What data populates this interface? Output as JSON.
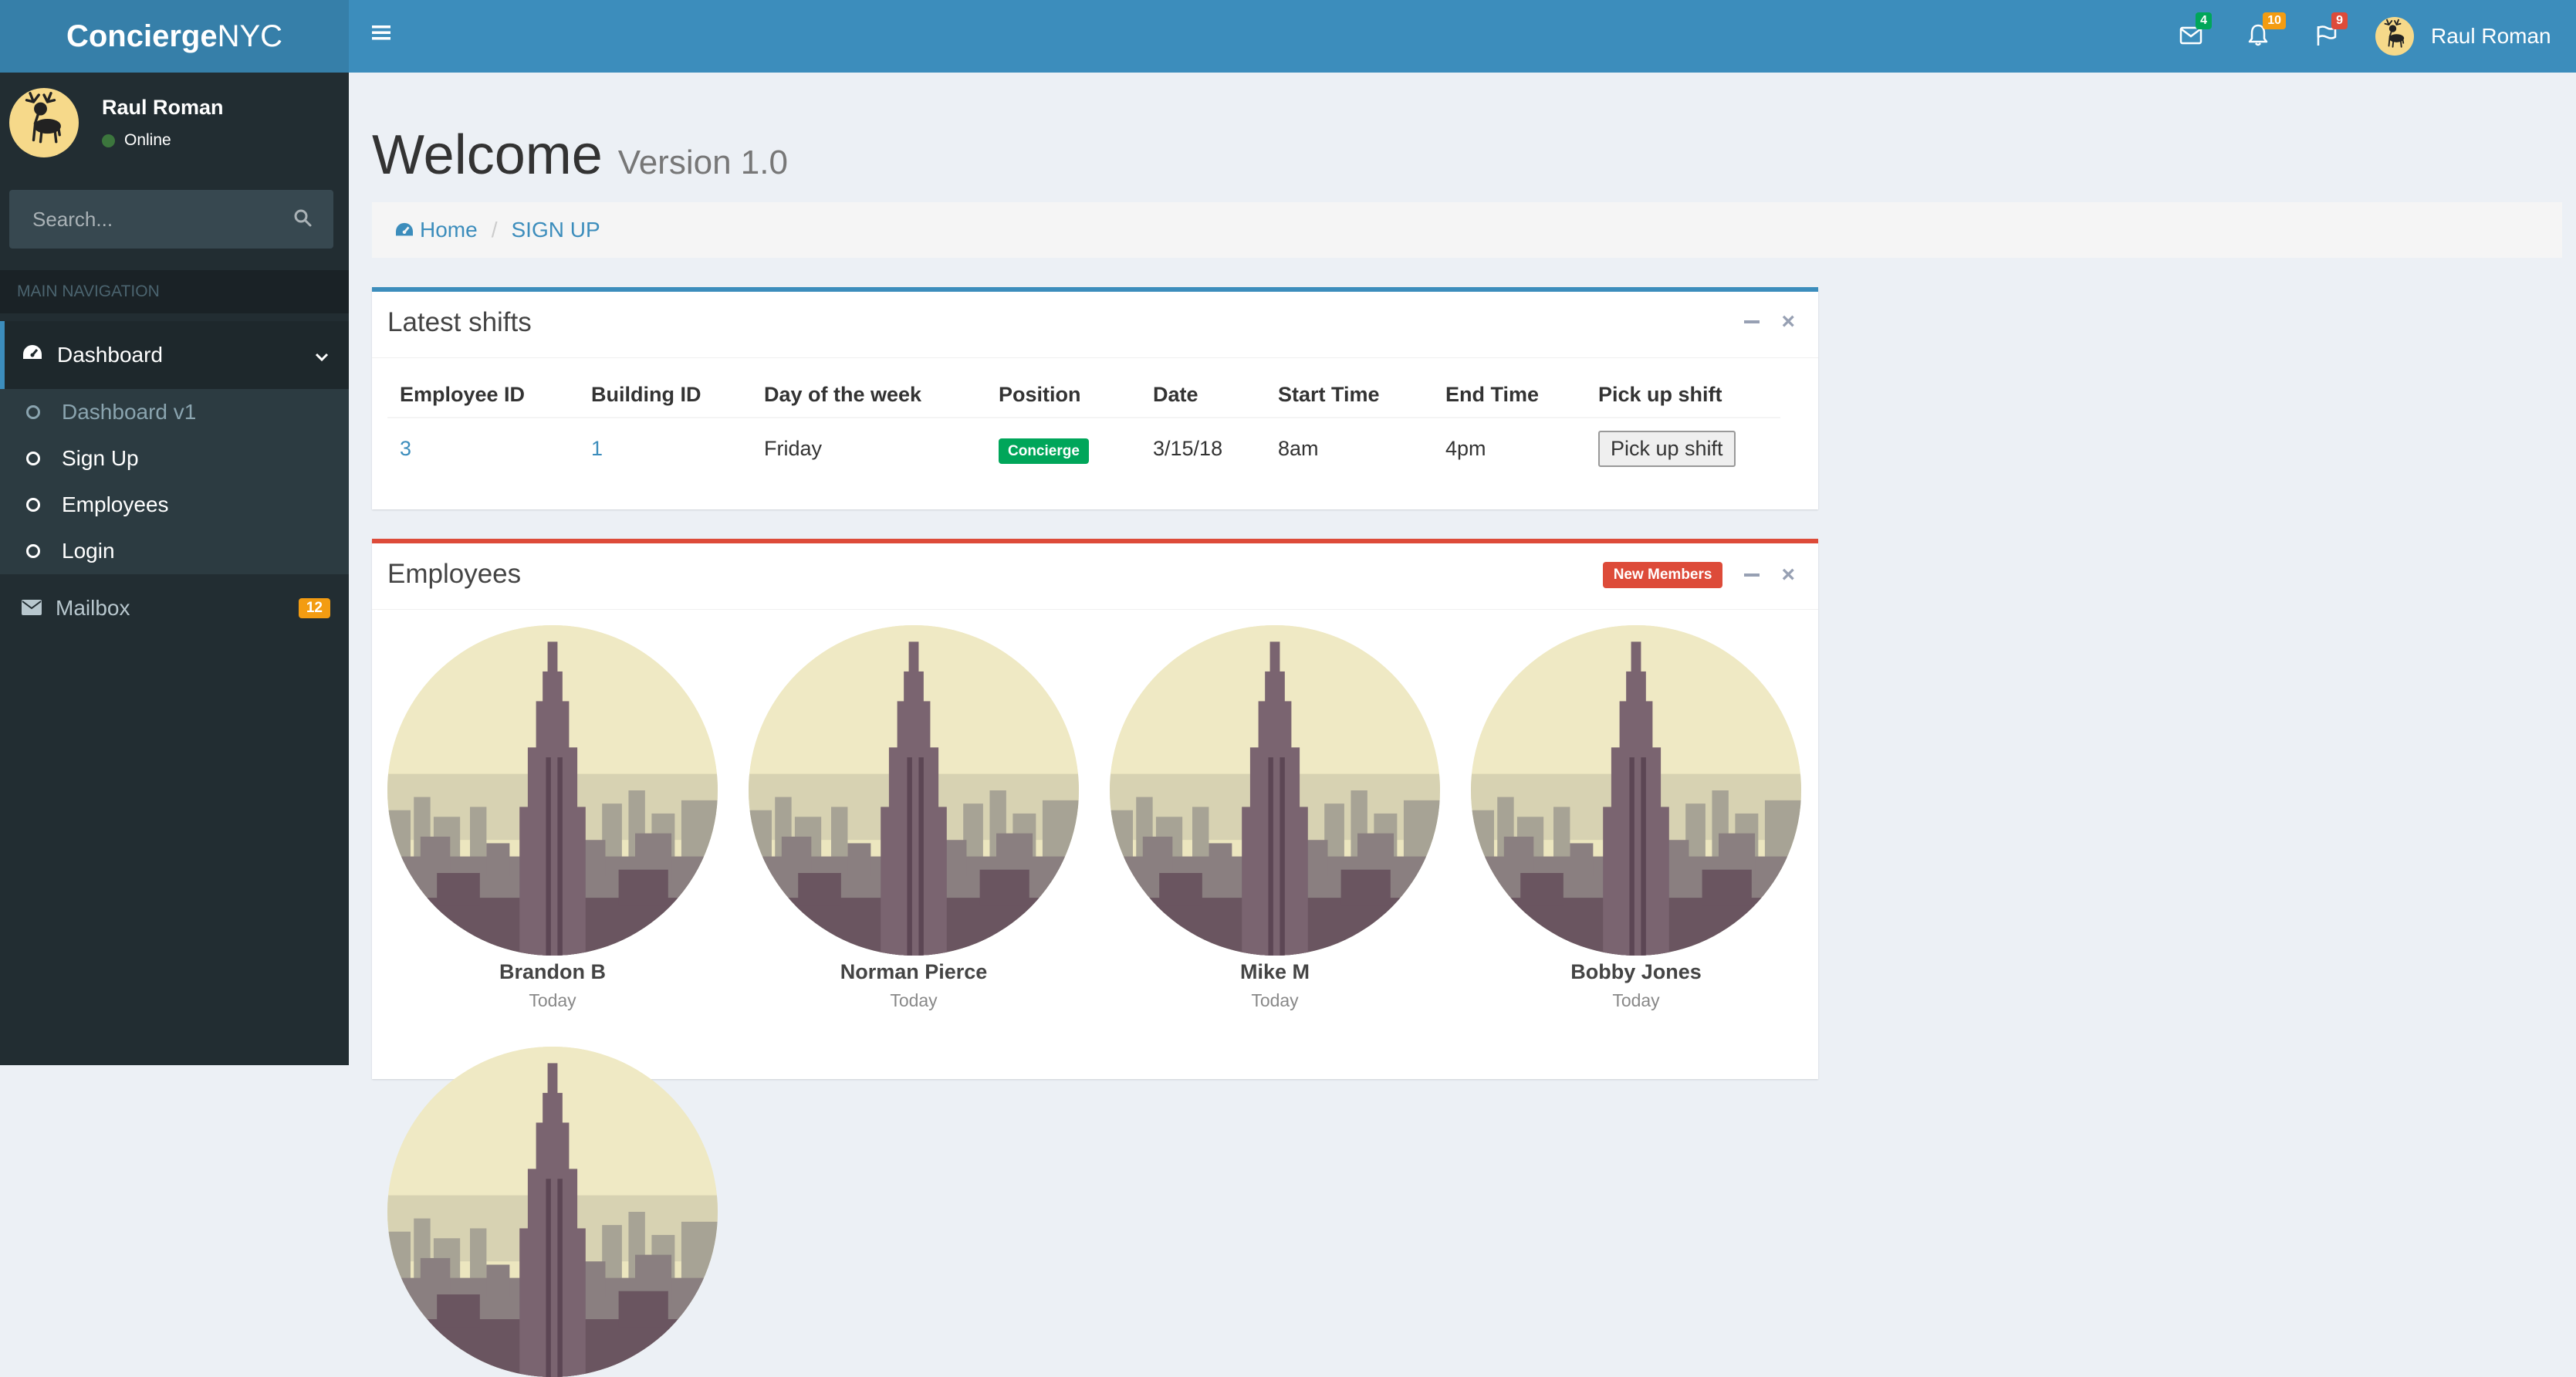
{
  "brand": {
    "bold": "Concierge",
    "light": "NYC"
  },
  "sidebar": {
    "user_name": "Raul Roman",
    "status": "Online",
    "search_placeholder": "Search...",
    "nav_header": "MAIN NAVIGATION",
    "dashboard_label": "Dashboard",
    "sub_items": [
      {
        "label": "Dashboard v1"
      },
      {
        "label": "Sign Up"
      },
      {
        "label": "Employees"
      },
      {
        "label": "Login"
      }
    ],
    "mailbox_label": "Mailbox",
    "mailbox_count": "12"
  },
  "topnav": {
    "messages_count": "4",
    "notifications_count": "10",
    "tasks_count": "9",
    "user_name": "Raul Roman"
  },
  "page": {
    "title": "Welcome",
    "subtitle": "Version 1.0",
    "breadcrumb": {
      "home": "Home",
      "current": "SIGN UP"
    }
  },
  "shifts": {
    "title": "Latest shifts",
    "columns": [
      "Employee ID",
      "Building ID",
      "Day of the week",
      "Position",
      "Date",
      "Start Time",
      "End Time",
      "Pick up shift"
    ],
    "rows": [
      {
        "employee_id": "3",
        "building_id": "1",
        "day": "Friday",
        "position": "Concierge",
        "date": "3/15/18",
        "start": "8am",
        "end": "4pm",
        "action": "Pick up shift"
      }
    ]
  },
  "employees": {
    "title": "Employees",
    "badge": "New Members",
    "members": [
      {
        "name": "Brandon B",
        "date": "Today"
      },
      {
        "name": "Norman Pierce",
        "date": "Today"
      },
      {
        "name": "Mike M",
        "date": "Today"
      },
      {
        "name": "Bobby Jones",
        "date": "Today"
      }
    ]
  },
  "colors": {
    "primary": "#3c8dbc",
    "sidebar": "#222d32",
    "danger": "#dd4b39",
    "success": "#00a65a",
    "warning": "#f39c12"
  }
}
